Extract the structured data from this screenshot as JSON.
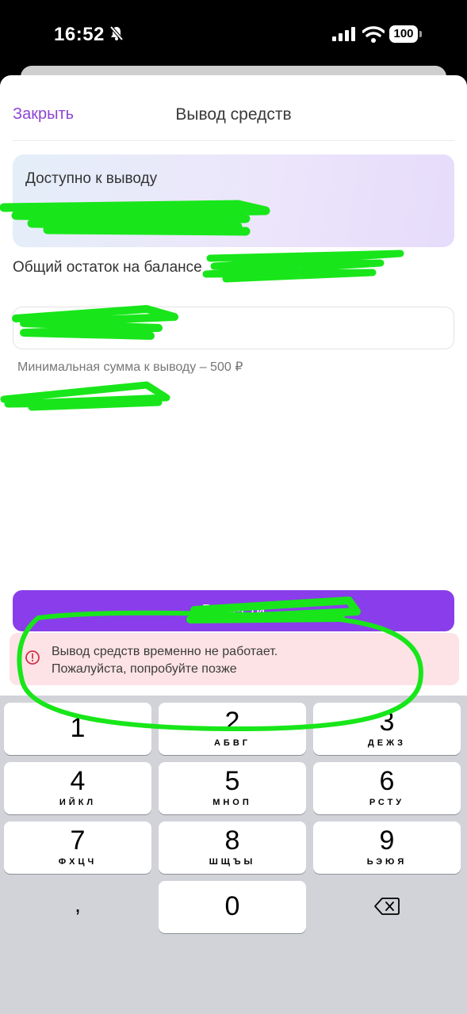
{
  "status_bar": {
    "time": "16:52",
    "battery": "100"
  },
  "header": {
    "close_label": "Закрыть",
    "title": "Вывод средств"
  },
  "available": {
    "label": "Доступно к выводу"
  },
  "balance": {
    "label": "Общий остаток на балансе"
  },
  "amount": {
    "placeholder": ""
  },
  "min_note": "Минимальная сумма к выводу –  500 ₽",
  "submit": {
    "label": "Вывести"
  },
  "error": {
    "line1": "Вывод средств временно не работает.",
    "line2": "Пожалуйста, попробуйте позже"
  },
  "keyboard": {
    "keys": [
      {
        "digit": "1",
        "letters": ""
      },
      {
        "digit": "2",
        "letters": "АБВГ"
      },
      {
        "digit": "3",
        "letters": "ДЕЖЗ"
      },
      {
        "digit": "4",
        "letters": "ИЙКЛ"
      },
      {
        "digit": "5",
        "letters": "МНОП"
      },
      {
        "digit": "6",
        "letters": "РСТУ"
      },
      {
        "digit": "7",
        "letters": "ФХЦЧ"
      },
      {
        "digit": "8",
        "letters": "ШЩЪЫ"
      },
      {
        "digit": "9",
        "letters": "ЬЭЮЯ"
      },
      {
        "digit": "0",
        "letters": ""
      }
    ],
    "comma": ","
  },
  "colors": {
    "accent": "#8a3dea",
    "link": "#8d44d6",
    "error_bg": "#fde3e6",
    "error_icon": "#d6324a",
    "scribble": "#18e61a"
  }
}
